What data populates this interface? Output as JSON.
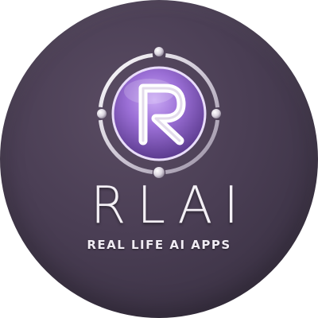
{
  "logo": {
    "wordmark": "RLAI",
    "monogram": "R",
    "tagline": "REAL LIFE AI APPS",
    "icon": "crosshair-target-icon",
    "colors": {
      "background": "#4a3e54",
      "accent": "#9b6fd6",
      "metal": "#e7e3ea"
    }
  }
}
